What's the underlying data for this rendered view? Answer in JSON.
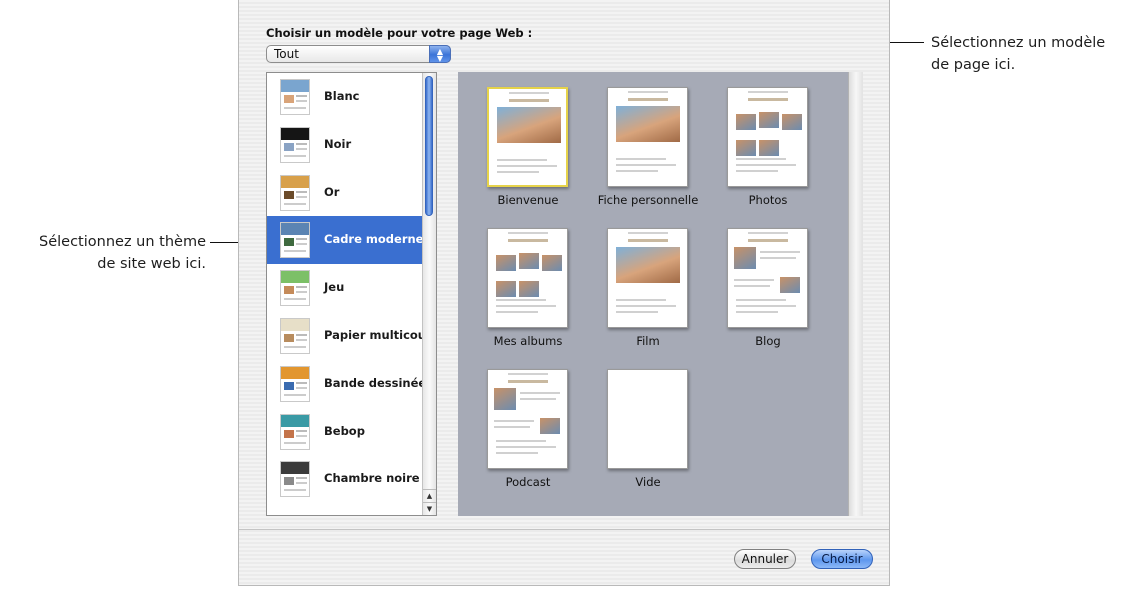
{
  "callouts": {
    "left": [
      "Sélectionnez un thème",
      "de site web ici."
    ],
    "right": [
      "Sélectionnez un modèle",
      "de page ici."
    ]
  },
  "dialog": {
    "title": "Choisir un modèle pour votre page Web :",
    "filter": {
      "selected": "Tout"
    }
  },
  "themes": [
    {
      "label": "Blanc",
      "a": "#7aa5cf",
      "b": "#d9a479"
    },
    {
      "label": "Noir",
      "a": "#151515",
      "b": "#8aa3c4"
    },
    {
      "label": "Or",
      "a": "#d8a04a",
      "b": "#6b4b2a"
    },
    {
      "label": "Cadre moderne",
      "a": "#5b84b3",
      "b": "#3f6a3f"
    },
    {
      "label": "Jeu",
      "a": "#7cc067",
      "b": "#c58b5a"
    },
    {
      "label": "Papier multicouche",
      "a": "#e7dfc8",
      "b": "#b88c5e"
    },
    {
      "label": "Bande dessinée",
      "a": "#e2962f",
      "b": "#3a6bb0"
    },
    {
      "label": "Bebop",
      "a": "#3a9aa5",
      "b": "#c4744a"
    },
    {
      "label": "Chambre noire",
      "a": "#3b3b3b",
      "b": "#8a8a8a"
    }
  ],
  "selected_theme": "Cadre moderne",
  "templates": [
    {
      "label": "Bienvenue"
    },
    {
      "label": "Fiche personnelle"
    },
    {
      "label": "Photos"
    },
    {
      "label": "Mes albums"
    },
    {
      "label": "Film"
    },
    {
      "label": "Blog"
    },
    {
      "label": "Podcast"
    },
    {
      "label": "Vide"
    }
  ],
  "selected_template": "Bienvenue",
  "buttons": {
    "cancel": "Annuler",
    "choose": "Choisir"
  },
  "icons": {
    "popup_arrows": "updown-arrows-icon",
    "scroll_up": "scroll-up-arrow-icon",
    "scroll_down": "scroll-down-arrow-icon"
  }
}
